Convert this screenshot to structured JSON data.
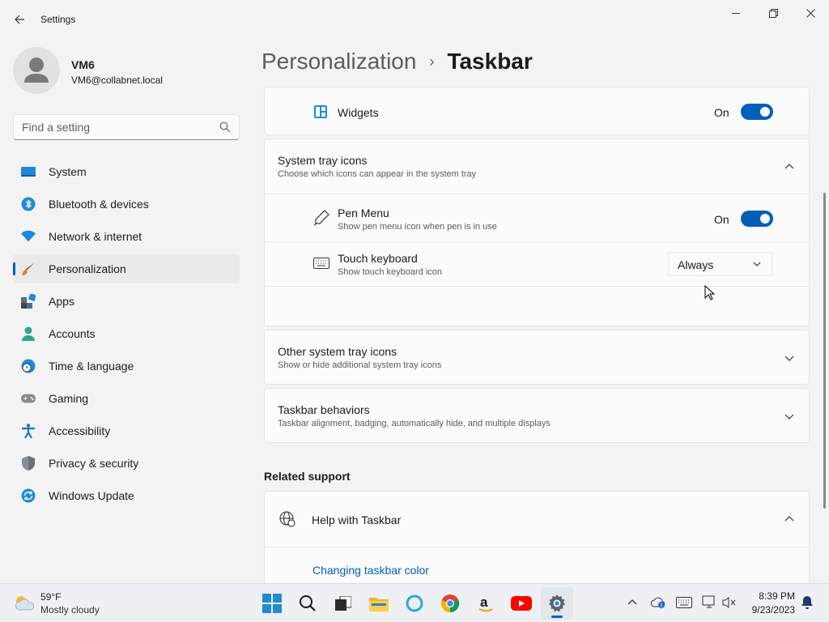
{
  "window": {
    "title": "Settings"
  },
  "user": {
    "name": "VM6",
    "email": "VM6@collabnet.local"
  },
  "search": {
    "placeholder": "Find a setting"
  },
  "nav": {
    "items": [
      {
        "label": "System",
        "icon": "system-icon"
      },
      {
        "label": "Bluetooth & devices",
        "icon": "bluetooth-icon"
      },
      {
        "label": "Network & internet",
        "icon": "wifi-icon"
      },
      {
        "label": "Personalization",
        "icon": "brush-icon",
        "active": true
      },
      {
        "label": "Apps",
        "icon": "apps-icon"
      },
      {
        "label": "Accounts",
        "icon": "accounts-icon"
      },
      {
        "label": "Time & language",
        "icon": "globe-clock-icon"
      },
      {
        "label": "Gaming",
        "icon": "gamepad-icon"
      },
      {
        "label": "Accessibility",
        "icon": "accessibility-icon"
      },
      {
        "label": "Privacy & security",
        "icon": "shield-icon"
      },
      {
        "label": "Windows Update",
        "icon": "update-icon"
      }
    ]
  },
  "breadcrumb": {
    "parent": "Personalization",
    "separator": "›",
    "current": "Taskbar"
  },
  "widgets": {
    "title": "Widgets",
    "state": "On",
    "enabled": true
  },
  "system_tray": {
    "title": "System tray icons",
    "subtitle": "Choose which icons can appear in the system tray",
    "expanded": true,
    "items": [
      {
        "title": "Pen Menu",
        "subtitle": "Show pen menu icon when pen is in use",
        "state": "On",
        "enabled": true
      },
      {
        "title": "Touch keyboard",
        "subtitle": "Show touch keyboard icon",
        "dropdown_value": "Always"
      }
    ]
  },
  "other_tray": {
    "title": "Other system tray icons",
    "subtitle": "Show or hide additional system tray icons"
  },
  "behaviors": {
    "title": "Taskbar behaviors",
    "subtitle": "Taskbar alignment, badging, automatically hide, and multiple displays"
  },
  "related": {
    "header": "Related support",
    "help_title": "Help with Taskbar",
    "link": "Changing taskbar color"
  },
  "taskbar": {
    "weather_temp": "59°F",
    "weather_desc": "Mostly cloudy",
    "time": "8:39 PM",
    "date": "9/23/2023"
  },
  "colors": {
    "accent": "#005fb8",
    "background": "#f3f3f3",
    "card": "#fbfbfb"
  }
}
